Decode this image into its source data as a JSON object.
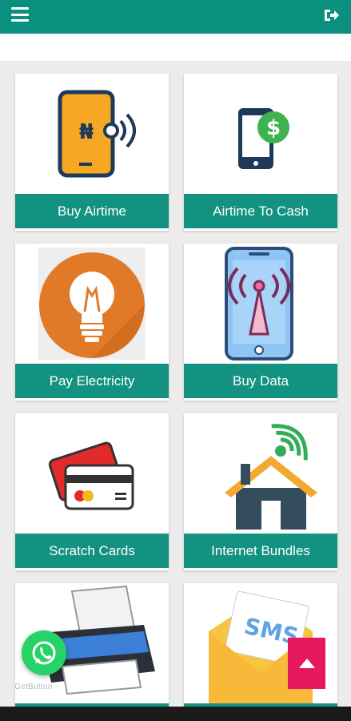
{
  "app": {
    "header_color": "#0b8f7f",
    "label_color": "#139281"
  },
  "header": {
    "menu_icon": "hamburger-menu-icon",
    "logout_icon": "sign-out-icon"
  },
  "services": [
    {
      "label": "Buy Airtime",
      "icon": "phone-naira-signal-icon"
    },
    {
      "label": "Airtime To Cash",
      "icon": "phone-dollar-coin-icon"
    },
    {
      "label": "Pay Electricity",
      "icon": "light-bulb-icon"
    },
    {
      "label": "Buy Data",
      "icon": "phone-antenna-signal-icon"
    },
    {
      "label": "Scratch Cards",
      "icon": "credit-cards-icon"
    },
    {
      "label": "Internet Bundles",
      "icon": "house-wifi-icon"
    },
    {
      "label": "",
      "icon": "printer-icon"
    },
    {
      "label": "",
      "icon": "sms-envelope-icon"
    }
  ],
  "floating": {
    "whatsapp_icon": "whatsapp-icon",
    "getbutton_text": "GetButton",
    "scroll_top_icon": "arrow-up-icon"
  }
}
